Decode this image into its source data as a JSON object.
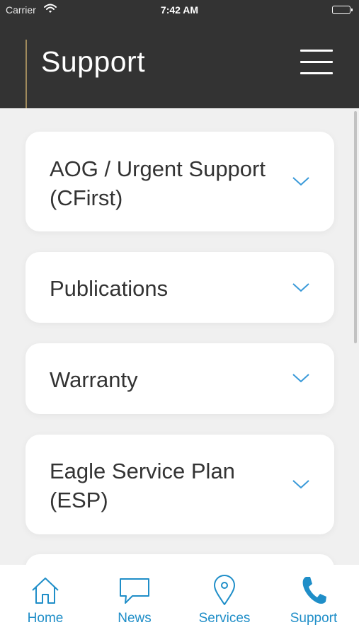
{
  "status_bar": {
    "carrier": "Carrier",
    "time": "7:42 AM",
    "wifi_icon": "wifi-icon",
    "battery_icon": "battery-icon"
  },
  "header": {
    "title": "Support",
    "menu_icon": "hamburger-menu-icon"
  },
  "cards": [
    {
      "title": "AOG / Urgent Support (CFirst)",
      "icon": "chevron-down-icon"
    },
    {
      "title": "Publications",
      "icon": "chevron-down-icon"
    },
    {
      "title": "Warranty",
      "icon": "chevron-down-icon"
    },
    {
      "title": "Eagle Service Plan (ESP)",
      "icon": "chevron-down-icon"
    }
  ],
  "tabs": [
    {
      "label": "Home",
      "icon": "home-icon"
    },
    {
      "label": "News",
      "icon": "speech-bubble-icon"
    },
    {
      "label": "Services",
      "icon": "location-pin-icon"
    },
    {
      "label": "Support",
      "icon": "phone-icon",
      "active": true
    }
  ],
  "colors": {
    "header_background": "#333333",
    "accent_gold": "#a08a5c",
    "link_blue": "#1f8ec8",
    "chevron_blue": "#3a9ad9",
    "page_background": "#f0f0f0",
    "card_background": "#ffffff",
    "card_text": "#333333"
  }
}
